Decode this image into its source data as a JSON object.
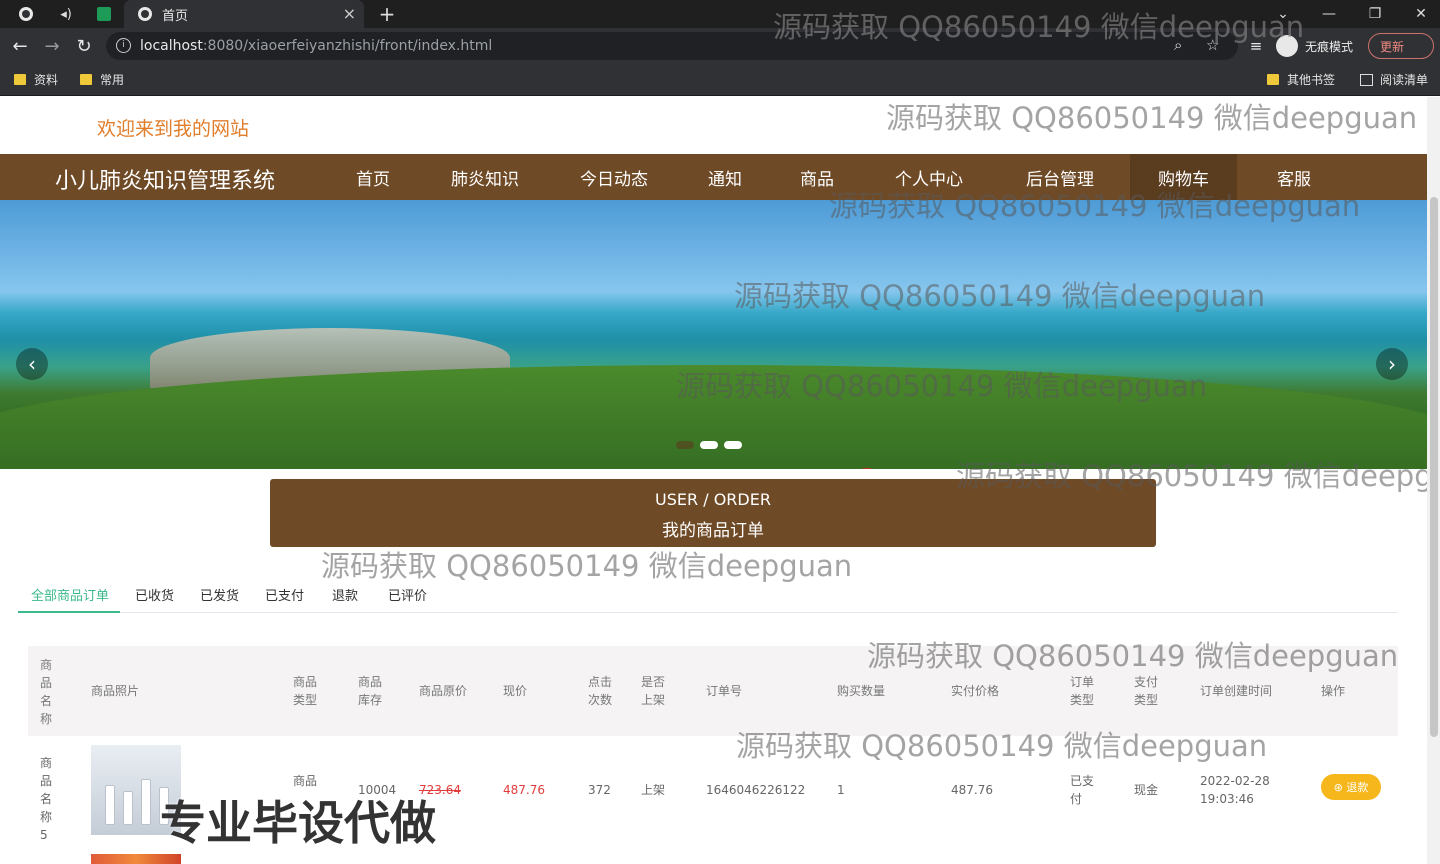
{
  "browser": {
    "tab_title": "首页",
    "url_host": "localhost",
    "url_rest": ":8080/xiaoerfeiyanzhishi/front/index.html",
    "incognito_label": "无痕模式",
    "update_label": "更新",
    "bookmarks": [
      "资料",
      "常用"
    ],
    "other_bookmarks": "其他书签",
    "reading_list": "阅读清单"
  },
  "site": {
    "welcome": "欢迎来到我的网站",
    "brand": "小儿肺炎知识管理系统",
    "nav": [
      "首页",
      "肺炎知识",
      "今日动态",
      "通知",
      "商品",
      "个人中心",
      "后台管理",
      "购物车",
      "客服"
    ],
    "active_nav": "购物车"
  },
  "order_banner": {
    "en": "USER / ORDER",
    "cn": "我的商品订单"
  },
  "order_tabs": [
    "全部商品订单",
    "已收货",
    "已发货",
    "已支付",
    "退款",
    "已评价"
  ],
  "table": {
    "headers": [
      "商品名称",
      "商品照片",
      "商品类型",
      "商品库存",
      "商品原价",
      "现价",
      "点击次数",
      "是否上架",
      "订单号",
      "购买数量",
      "实付价格",
      "订单类型",
      "支付类型",
      "订单创建时间",
      "操作"
    ],
    "row": {
      "name": "商品名称5",
      "type": "商品",
      "stock": "10004",
      "original_price": "723.64",
      "price": "487.76",
      "clicks": "372",
      "on_sale": "上架",
      "order_no": "1646046226122",
      "quantity": "1",
      "paid": "487.76",
      "order_type": "已支付",
      "pay_type": "现金",
      "created_date": "2022-02-28",
      "created_time": "19:03:46",
      "action": "退款"
    }
  },
  "watermark": "源码获取 QQ86050149 微信deepguan",
  "promo": "专业毕设代做",
  "colors": {
    "brand_brown": "#6f4a26",
    "welcome_orange": "#e07e2c",
    "tab_green": "#3bb98b",
    "price_red": "#e23c3c"
  }
}
